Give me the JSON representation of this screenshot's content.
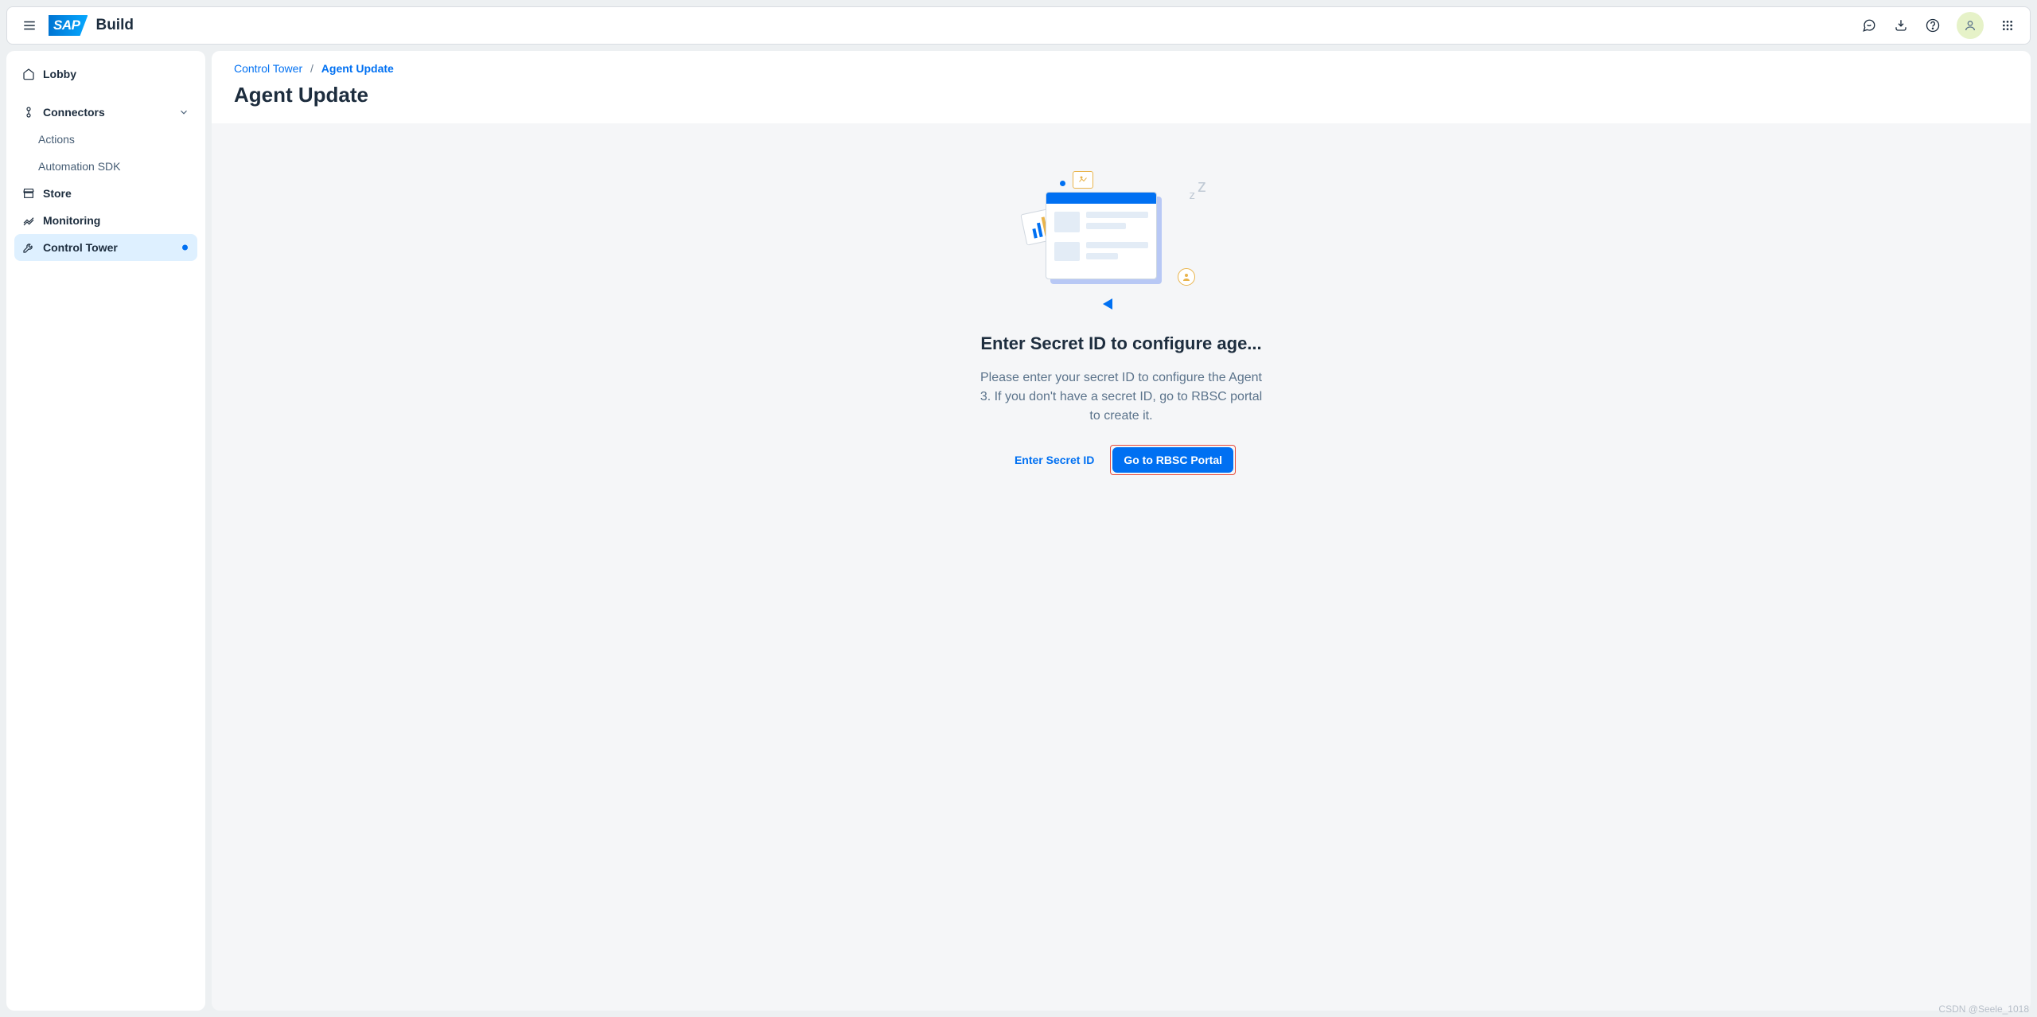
{
  "header": {
    "logo_text": "SAP",
    "product": "Build"
  },
  "sidebar": {
    "lobby": "Lobby",
    "connectors": "Connectors",
    "connectors_children": {
      "actions": "Actions",
      "automation_sdk": "Automation SDK"
    },
    "store": "Store",
    "monitoring": "Monitoring",
    "control_tower": "Control Tower"
  },
  "breadcrumb": {
    "root": "Control Tower",
    "current": "Agent Update"
  },
  "page": {
    "title": "Agent Update"
  },
  "empty": {
    "title": "Enter Secret ID to configure age...",
    "description": "Please enter your secret ID to configure the Agent 3. If you don't have a secret ID, go to RBSC portal to create it.",
    "button_secondary": "Enter Secret ID",
    "button_primary": "Go to RBSC Portal"
  },
  "watermark": "CSDN @Seele_1018"
}
